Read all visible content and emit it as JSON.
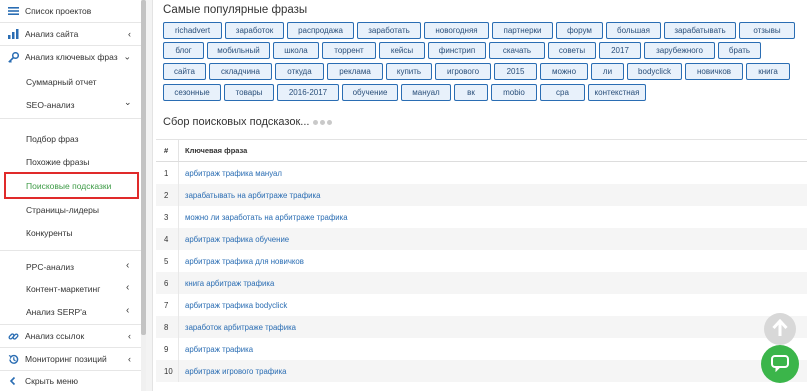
{
  "sidebar": {
    "top_items": [
      {
        "label": "Список проектов",
        "icon": "list-icon"
      },
      {
        "label": "Анализ сайта",
        "icon": "chart-icon"
      },
      {
        "label": "Анализ ключевых фраз",
        "icon": "key-icon"
      }
    ],
    "keyword_sub": {
      "summary": "Суммарный отчет",
      "seo": "SEO-анализ",
      "seo_items": [
        "Подбор фраз",
        "Похожие фразы",
        "Поисковые подсказки",
        "Страницы-лидеры",
        "Конкуренты"
      ],
      "other_sections": [
        "PPC-анализ",
        "Контент-маркетинг",
        "Анализ SERP'а"
      ]
    },
    "bottom_items": [
      {
        "label": "Анализ ссылок",
        "icon": "link-icon"
      },
      {
        "label": "Мониторинг позиций",
        "icon": "history-icon"
      },
      {
        "label": "Скрыть меню",
        "icon": "collapse-icon"
      }
    ],
    "active": "Поисковые подсказки"
  },
  "popular": {
    "title": "Самые популярные фразы",
    "tags_row1": [
      "richadvert",
      "заработок",
      "распродажа",
      "заработать",
      "новогодняя",
      "партнерки",
      "форум",
      "большая",
      "зарабатывать",
      "отзывы"
    ],
    "tags_row2": [
      "блог",
      "мобильный",
      "школа",
      "торрент",
      "кейсы",
      "финстрип",
      "скачать",
      "советы",
      "2017",
      "зарубежного",
      "брать"
    ],
    "tags_row3": [
      "сайта",
      "складчина",
      "откуда",
      "реклама",
      "купить",
      "игрового",
      "2015",
      "можно",
      "ли",
      "bodyclick",
      "новичков",
      "книга"
    ],
    "tags_row4": [
      "сезонные",
      "товары",
      "2016-2017",
      "обучение",
      "мануал",
      "вк",
      "mobio",
      "cpa",
      "контекстная"
    ]
  },
  "collect": {
    "title": "Сбор поисковых подсказок..."
  },
  "table": {
    "col_num": "#",
    "col_phrase": "Ключевая фраза",
    "rows": [
      {
        "n": "1",
        "phrase": "арбитраж трафика мануал"
      },
      {
        "n": "2",
        "phrase": "зарабатывать на арбитраже трафика"
      },
      {
        "n": "3",
        "phrase": "можно ли заработать на арбитраже трафика"
      },
      {
        "n": "4",
        "phrase": "арбитраж трафика обучение"
      },
      {
        "n": "5",
        "phrase": "арбитраж трафика для новичков"
      },
      {
        "n": "6",
        "phrase": "книга арбитраж трафика"
      },
      {
        "n": "7",
        "phrase": "арбитраж трафика bodyclick"
      },
      {
        "n": "8",
        "phrase": "заработок арбитраже трафика"
      },
      {
        "n": "9",
        "phrase": "арбитраж трафика"
      },
      {
        "n": "10",
        "phrase": "арбитраж игрового трафика"
      }
    ]
  }
}
